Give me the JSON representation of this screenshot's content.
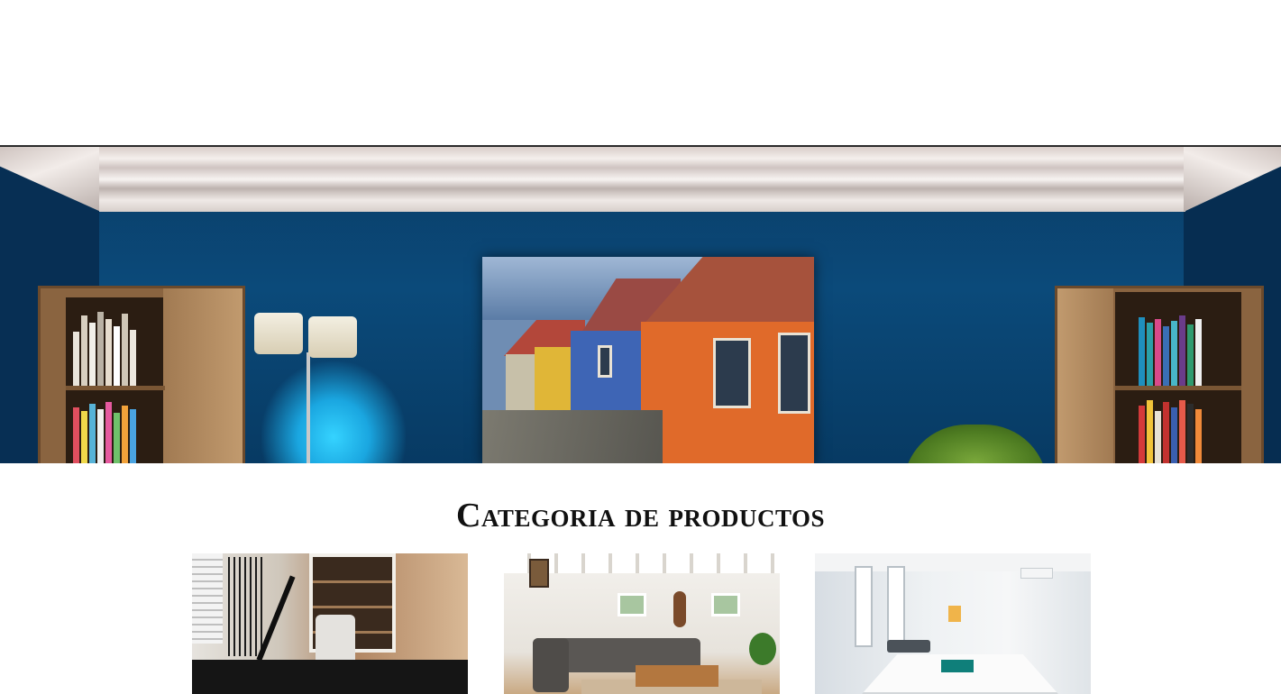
{
  "hero": {
    "alt": "Sala con pared azul, cuadro de casas de colores, lámpara de pie y estanterías"
  },
  "categories": {
    "title": "Categoria de productos",
    "items": [
      {
        "alt": "Oficina en casa"
      },
      {
        "alt": "Sala de estar"
      },
      {
        "alt": "Oficina"
      }
    ]
  },
  "colors": {
    "wall": "#0b4a7a",
    "lamp_glow": "#1aa6e0",
    "title_text": "#111111",
    "background": "#ffffff"
  }
}
